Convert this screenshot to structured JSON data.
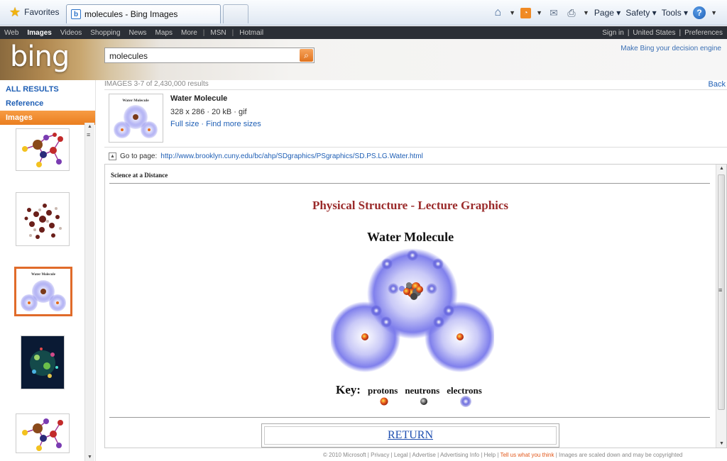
{
  "browser": {
    "favorites_label": "Favorites",
    "tab_title": "molecules - Bing Images",
    "menu_page": "Page",
    "menu_safety": "Safety",
    "menu_tools": "Tools"
  },
  "bing": {
    "nav": [
      "Web",
      "Images",
      "Videos",
      "Shopping",
      "News",
      "Maps",
      "More",
      "MSN",
      "Hotmail"
    ],
    "active_nav": "Images",
    "top_right": [
      "Sign in",
      "United States",
      "Preferences"
    ],
    "logo": "bing",
    "search_value": "molecules",
    "tagline": "Make Bing your decision engine"
  },
  "left_nav": {
    "items": [
      "ALL RESULTS",
      "Reference",
      "Images"
    ],
    "selected": "Images"
  },
  "results": {
    "header": "IMAGES  3-7 of 2,430,000 results",
    "back": "Back",
    "detail": {
      "thumb_caption": "Water Molecule",
      "title": "Water Molecule",
      "meta": "328 x 286 · 20 kB · gif",
      "link_full": "Full size",
      "link_sep": "·",
      "link_more": "Find more sizes"
    },
    "goto_label": "Go to page:",
    "goto_url": "http://www.brooklyn.cuny.edu/bc/ahp/SDgraphics/PSgraphics/SD.PS.LG.Water.html"
  },
  "page": {
    "site_title": "Science at a Distance",
    "heading": "Physical Structure - Lecture Graphics",
    "subheading": "Water Molecule",
    "key_label": "Key:",
    "key_items": [
      "protons",
      "neutrons",
      "electrons"
    ],
    "return_label": "RETURN"
  },
  "footer": {
    "text_before": "© 2010 Microsoft  |  Privacy  |  Legal  |  Advertise  |  Advertising Info  |  Help  |  ",
    "tell": "Tell us what you think",
    "text_after": "  |  Images are scaled down and may be copyrighted"
  },
  "colors": {
    "accent_orange": "#ea7e1f",
    "link_blue": "#1f5fb5",
    "heading_red": "#9a2a2a"
  }
}
